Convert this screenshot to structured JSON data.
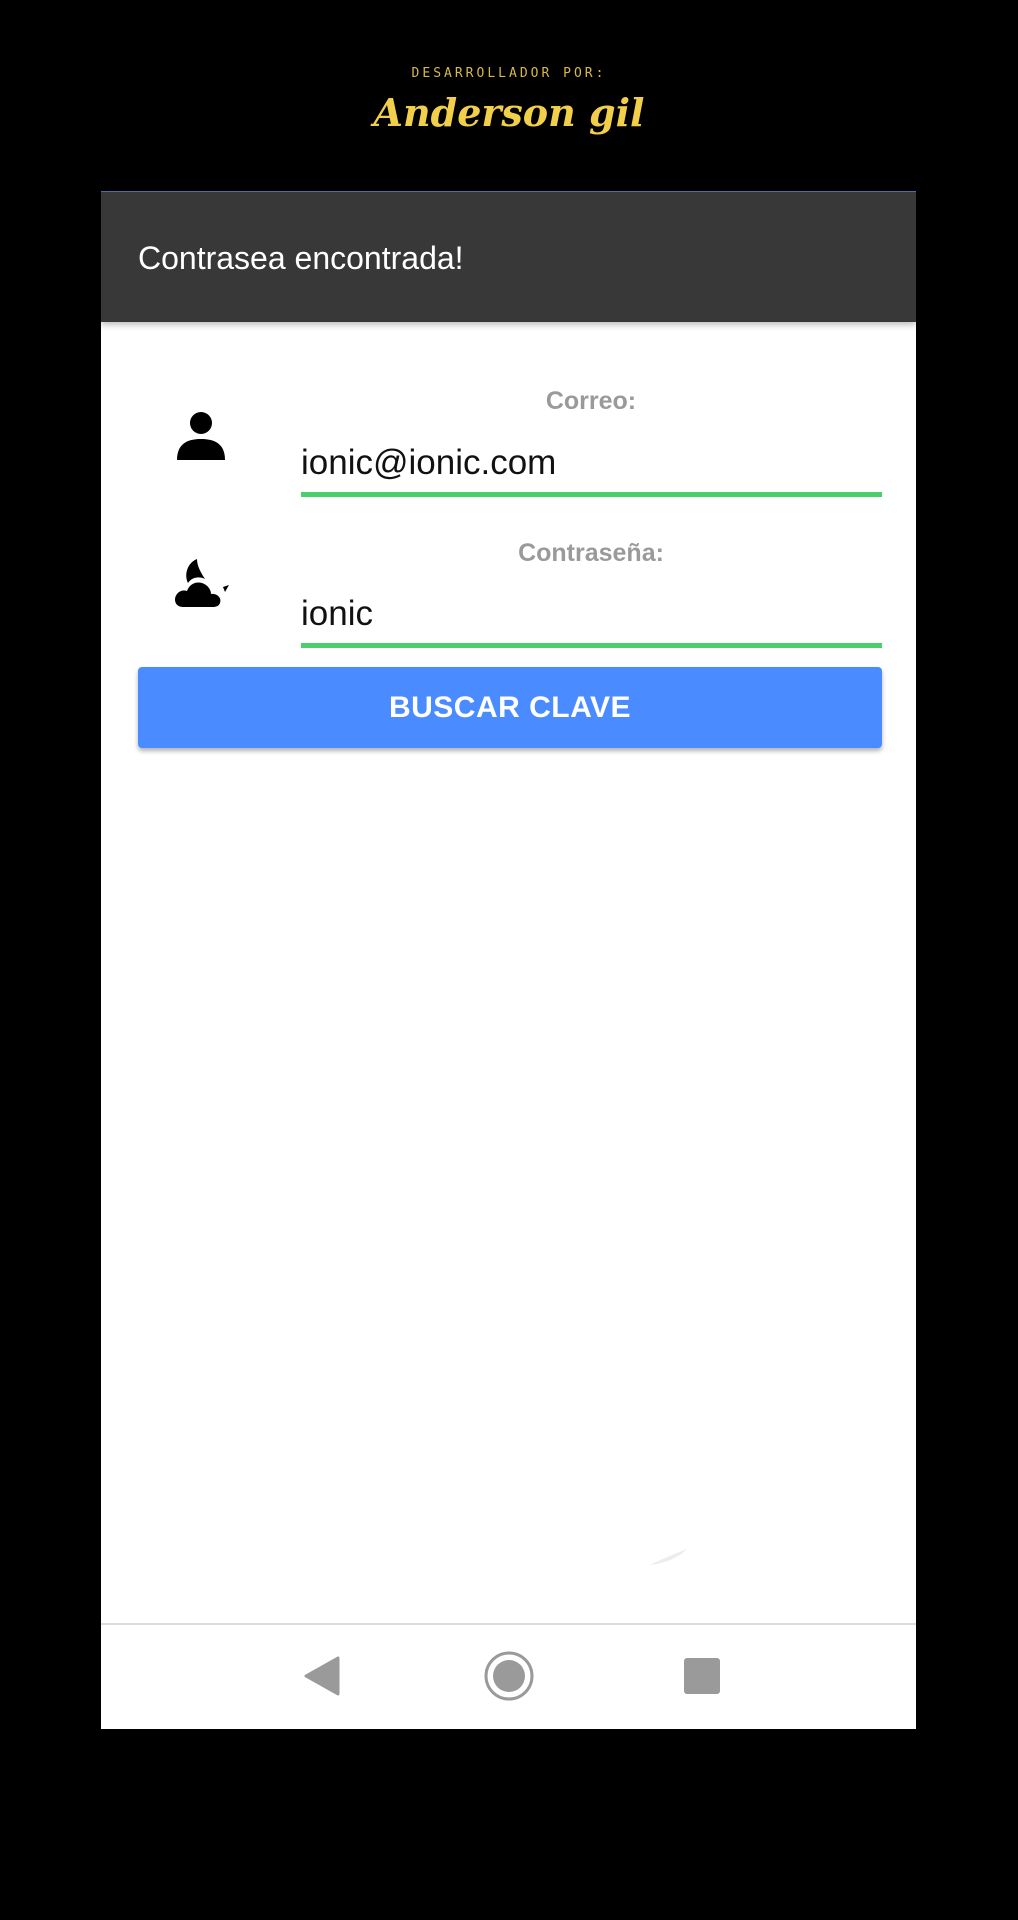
{
  "credit": {
    "label": "DESARROLLADOR POR:",
    "signature": "Anderson gil"
  },
  "toolbar": {
    "title": "Contrasea encontrada!"
  },
  "form": {
    "email": {
      "label": "Correo:",
      "value": "ionic@ionic.com",
      "icon": "person-icon"
    },
    "password": {
      "label": "Contraseña:",
      "value": "ionic",
      "icon": "cloudy-night-icon"
    },
    "submit_label": "BUSCAR CLAVE"
  },
  "navbar": {
    "items": [
      "back-icon",
      "home-icon",
      "recents-icon"
    ]
  },
  "colors": {
    "toolbar_bg": "#383838",
    "accent_button": "#4a8cff",
    "input_underline": "#4ccf6a",
    "credit_gold": "#f2cf4b"
  }
}
